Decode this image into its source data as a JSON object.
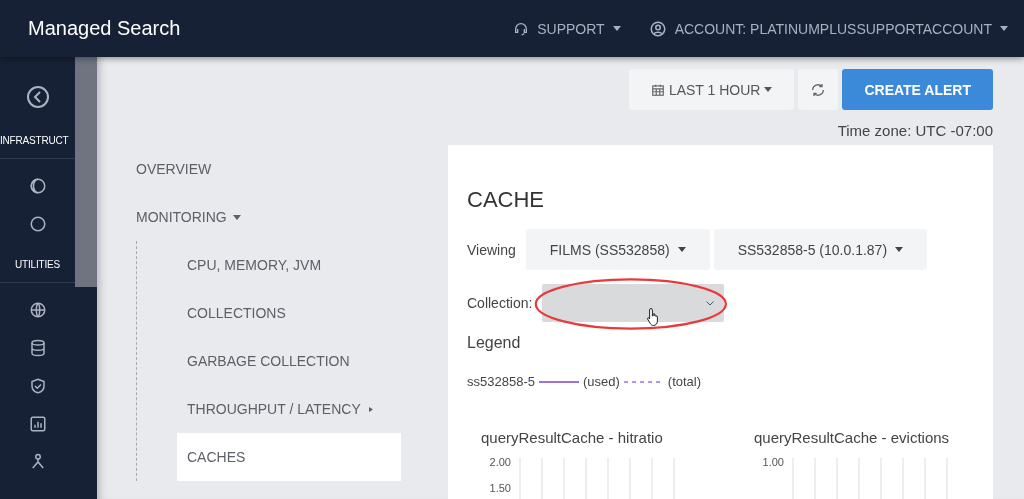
{
  "header": {
    "title": "Managed Search",
    "support": "SUPPORT",
    "account": "ACCOUNT: PLATINUMPLUSSUPPORTACCOUNT"
  },
  "rail": [
    {
      "kind": "infrastructure",
      "label": "INFRASTRUCT"
    },
    {
      "kind": "utilities",
      "label": "UTILITIES"
    }
  ],
  "toolbar": {
    "range": "LAST 1 HOUR",
    "create": "CREATE ALERT",
    "timezone": "Time zone: UTC -07:00"
  },
  "nav": [
    {
      "label": "OVERVIEW",
      "kind": "link",
      "selected": false
    },
    {
      "label": "MONITORING",
      "kind": "group",
      "expanded": true,
      "selected": false,
      "children": [
        {
          "label": "CPU, MEMORY, JVM",
          "kind": "link",
          "selected": false
        },
        {
          "label": "COLLECTIONS",
          "kind": "link",
          "selected": false
        },
        {
          "label": "GARBAGE COLLECTION",
          "kind": "link",
          "selected": false
        },
        {
          "label": "THROUGHPUT / LATENCY",
          "kind": "group",
          "expanded": false,
          "selected": false
        },
        {
          "label": "CACHES",
          "kind": "link",
          "selected": true
        }
      ]
    }
  ],
  "card": {
    "title": "CACHE",
    "viewing_label": "Viewing",
    "selects": [
      "FILMS (SS532858)",
      "SS532858-5 (10.0.1.87)"
    ],
    "collection_label": "Collection:",
    "legend_title": "Legend",
    "legend": {
      "series": "ss532858-5",
      "color": "#9b72e0",
      "used": "(used)",
      "total": "(total)"
    },
    "charts": [
      {
        "title": "queryResultCache - hitratio",
        "ticks": [
          "2.00",
          "1.50"
        ]
      },
      {
        "title": "queryResultCache - evictions",
        "ticks": [
          "1.00"
        ]
      }
    ]
  }
}
